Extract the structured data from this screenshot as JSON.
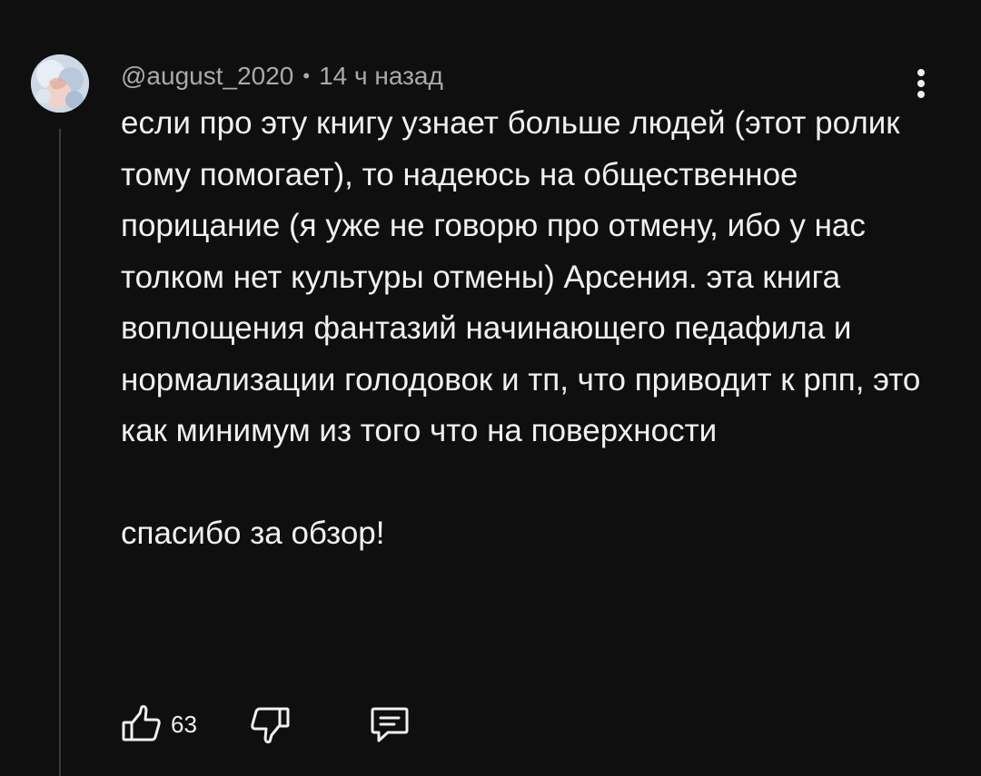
{
  "comment": {
    "author": "@august_2020",
    "separator": "•",
    "time": "14 ч назад",
    "text": "если про эту книгу узнает больше людей (этот ролик тому помогает), то надеюсь на общественное порицание (я уже не говорю про отмену, ибо у нас толком нет культуры отмены) Арсения. эта книга воплощения фантазий начинающего педафила и нормализации голодовок и тп, что приводит к рпп, это как минимум из того что на поверхности\n\nспасибо за обзор!",
    "like_count": "63"
  },
  "icons": {
    "like": "thumbs-up-icon",
    "dislike": "thumbs-down-icon",
    "reply": "reply-comment-icon",
    "more": "more-vertical-icon"
  }
}
